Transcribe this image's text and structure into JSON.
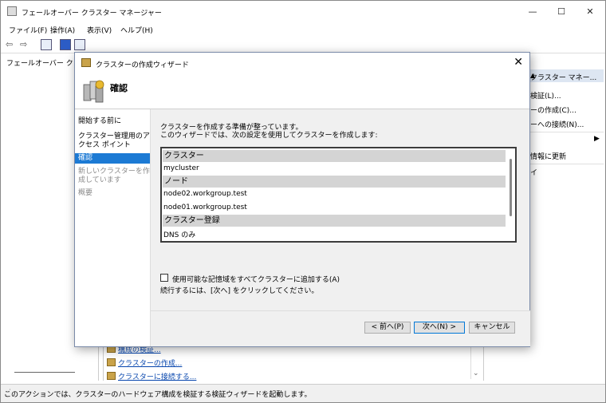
{
  "window": {
    "title": "フェールオーバー クラスター マネージャー",
    "controls": {
      "minimize": "—",
      "maximize": "☐",
      "close": "✕"
    }
  },
  "menu": [
    "ファイル(F)",
    "操作(A)",
    "表示(V)",
    "ヘルプ(H)"
  ],
  "tree": {
    "root_label": "フェールオーバー クラ"
  },
  "center_links": [
    "構成の検証...",
    "クラスターの作成...",
    "クラスターに接続する..."
  ],
  "actions": {
    "header": "クラスター マネー...",
    "items": [
      "検証(L)...",
      "ーの作成(C)...",
      "ーへの接続(N)...",
      "",
      "情報に更新",
      "イ"
    ]
  },
  "status": {
    "text": "このアクションでは、クラスターのハードウェア構成を検証する検証ウィザードを起動します。"
  },
  "wizard": {
    "title": "クラスターの作成ウィザード",
    "heading": "確認",
    "steps": [
      {
        "label": "開始する前に",
        "state": "normal"
      },
      {
        "label": "クラスター管理用のアクセス ポイント",
        "state": "normal"
      },
      {
        "label": "確認",
        "state": "active"
      },
      {
        "label": "新しいクラスターを作成しています",
        "state": "disabled"
      },
      {
        "label": "概要",
        "state": "disabled"
      }
    ],
    "intro_line1": "クラスターを作成する準備が整っています。",
    "intro_line2": "このウィザードでは、次の設定を使用してクラスターを作成します:",
    "listbox": {
      "section_cluster": "クラスター",
      "cluster_name": "mycluster",
      "section_node": "ノード",
      "node1": "node02.workgroup.test",
      "node2": "node01.workgroup.test",
      "section_registration": "クラスター登録",
      "registration": "DNS のみ"
    },
    "checkbox_label": "使用可能な記憶域をすべてクラスターに追加する(A)",
    "checkbox_checked": false,
    "continue_hint": "続行するには、[次へ] をクリックしてください。",
    "buttons": {
      "prev": "< 前へ(P)",
      "next": "次へ(N) >",
      "cancel": "キャンセル"
    }
  },
  "colors": {
    "accent": "#1c7ad4",
    "section_bg": "#d4d4d4"
  }
}
